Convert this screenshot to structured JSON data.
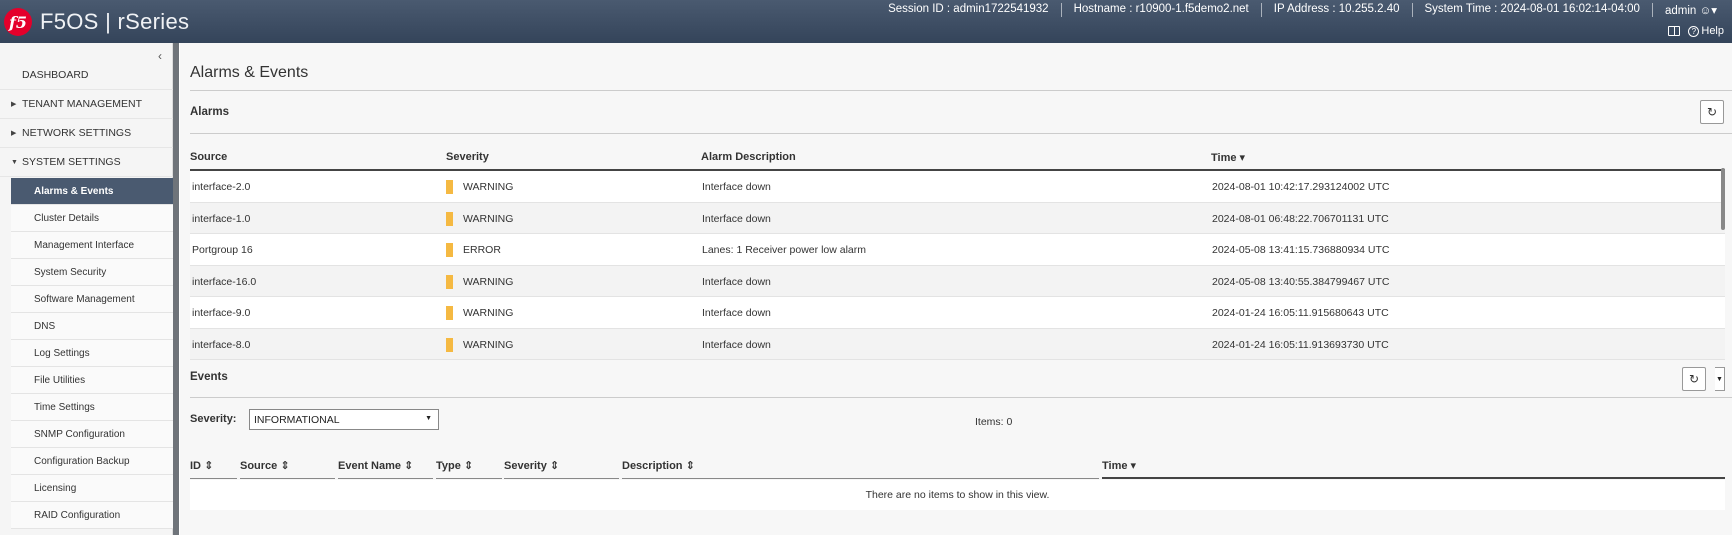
{
  "header": {
    "logo_text": "f5",
    "product": "F5OS | rSeries",
    "session": "Session ID : admin1722541932",
    "hostname": "Hostname : r10900-1.f5demo2.net",
    "ip": "IP Address : 10.255.2.40",
    "time": "System Time : 2024-08-01 16:02:14-04:00",
    "user": "admin",
    "help": "Help"
  },
  "sidebar": {
    "collapse_glyph": "‹",
    "top": [
      {
        "label": "DASHBOARD"
      },
      {
        "label": "TENANT MANAGEMENT"
      },
      {
        "label": "NETWORK SETTINGS"
      },
      {
        "label": "SYSTEM SETTINGS"
      }
    ],
    "sub": [
      {
        "label": "Alarms & Events"
      },
      {
        "label": "Cluster Details"
      },
      {
        "label": "Management Interface"
      },
      {
        "label": "System Security"
      },
      {
        "label": "Software Management"
      },
      {
        "label": "DNS"
      },
      {
        "label": "Log Settings"
      },
      {
        "label": "File Utilities"
      },
      {
        "label": "Time Settings"
      },
      {
        "label": "SNMP Configuration"
      },
      {
        "label": "Configuration Backup"
      },
      {
        "label": "Licensing"
      },
      {
        "label": "RAID Configuration"
      }
    ]
  },
  "main": {
    "title": "Alarms & Events",
    "alarms": {
      "title": "Alarms",
      "columns": [
        "Source",
        "Severity",
        "Alarm Description",
        "Time"
      ],
      "rows": [
        {
          "source": "interface-2.0",
          "severity": "WARNING",
          "desc": "Interface down",
          "time": "2024-08-01 10:42:17.293124002 UTC"
        },
        {
          "source": "interface-1.0",
          "severity": "WARNING",
          "desc": "Interface down",
          "time": "2024-08-01 06:48:22.706701131 UTC"
        },
        {
          "source": "Portgroup 16",
          "severity": "ERROR",
          "desc": "Lanes: 1 Receiver power low alarm",
          "time": "2024-05-08 13:41:15.736880934 UTC"
        },
        {
          "source": "interface-16.0",
          "severity": "WARNING",
          "desc": "Interface down",
          "time": "2024-05-08 13:40:55.384799467 UTC"
        },
        {
          "source": "interface-9.0",
          "severity": "WARNING",
          "desc": "Interface down",
          "time": "2024-01-24 16:05:11.915680643 UTC"
        },
        {
          "source": "interface-8.0",
          "severity": "WARNING",
          "desc": "Interface down",
          "time": "2024-01-24 16:05:11.913693730 UTC"
        }
      ]
    },
    "events": {
      "title": "Events",
      "severity_label": "Severity:",
      "severity_value": "INFORMATIONAL",
      "items": "Items: 0",
      "columns": [
        "ID",
        "Source",
        "Event Name",
        "Type",
        "Severity",
        "Description",
        "Time"
      ],
      "empty": "There are no items to show in this view."
    }
  },
  "colors": {
    "header": "#3d4c62",
    "active": "#4a5a70",
    "severity_bar": "#f5b942",
    "logo": "#e4002b"
  }
}
